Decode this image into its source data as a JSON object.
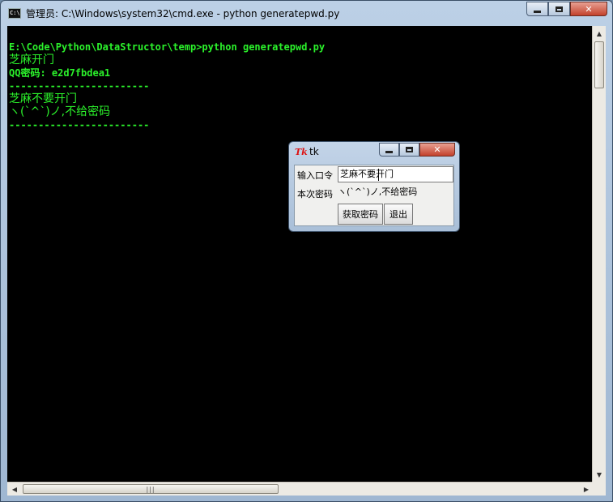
{
  "cmd": {
    "title": "管理员: C:\\Windows\\system32\\cmd.exe - python  generatepwd.py",
    "icon_text": "C:\\",
    "lines": [
      "E:\\Code\\Python\\DataStructor\\temp>python generatepwd.py",
      "芝麻开门",
      "QQ密码: e2d7fbdea1",
      "------------------------",
      "芝麻不要开门",
      "ヽ(`^`)ノ,不给密码",
      "------------------------"
    ],
    "scroll_up": "▲",
    "scroll_down": "▼",
    "scroll_left": "◀",
    "scroll_right": "▶",
    "hthumb_grip": "|||"
  },
  "tk": {
    "title": "tk",
    "icon_text": "Tk",
    "label_input": "输入口令",
    "input_value": "芝麻不要开门",
    "label_password": "本次密码",
    "password_value": "ヽ(`^`)ノ,不给密码",
    "get_button": "获取密码",
    "quit_button": "退出"
  },
  "colors": {
    "console_text": "#2bf22b",
    "console_bg": "#000000"
  }
}
